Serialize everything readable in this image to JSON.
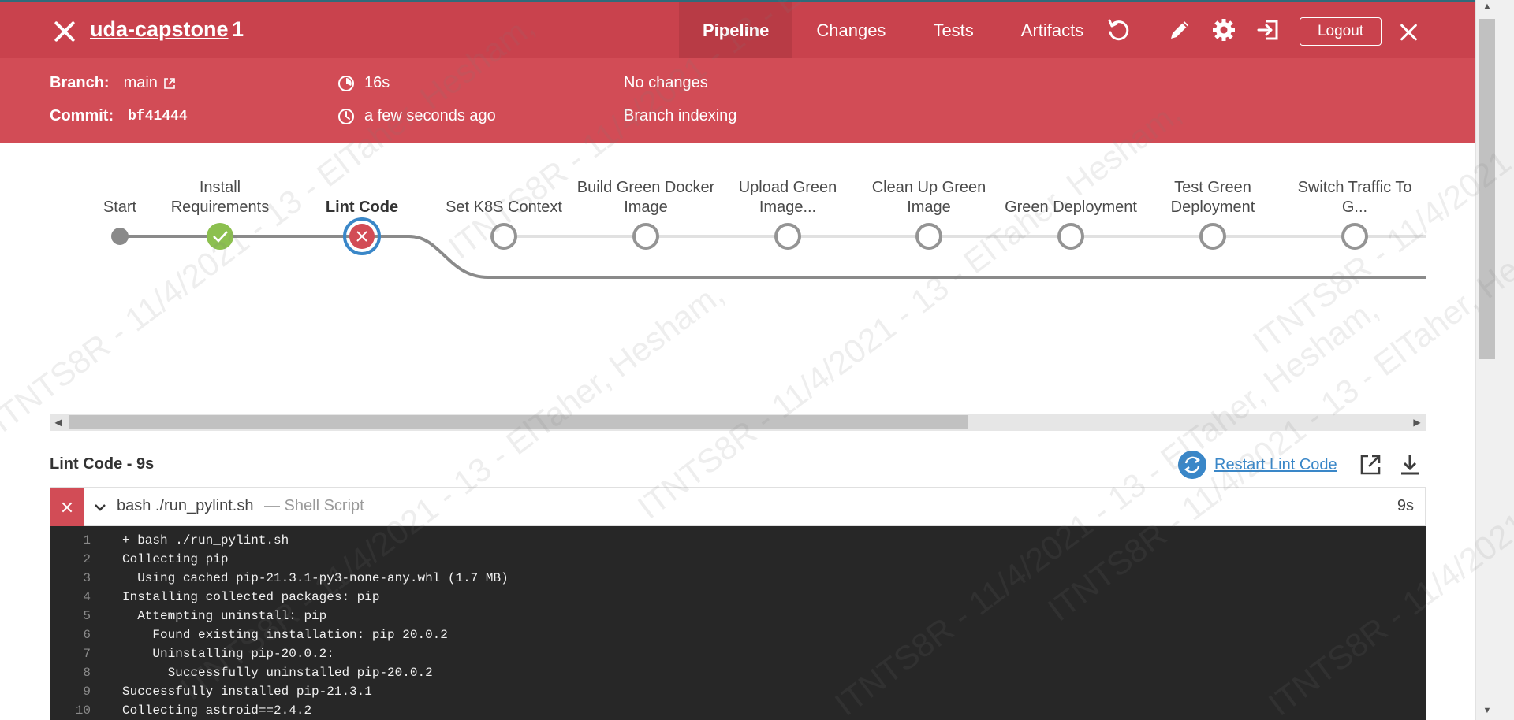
{
  "header": {
    "title": "uda-capstone",
    "run_number": "1",
    "tabs": [
      {
        "label": "Pipeline",
        "active": true
      },
      {
        "label": "Changes",
        "active": false
      },
      {
        "label": "Tests",
        "active": false
      },
      {
        "label": "Artifacts",
        "active": false
      }
    ],
    "logout_label": "Logout"
  },
  "info": {
    "branch_label": "Branch:",
    "branch_value": "main",
    "commit_label": "Commit:",
    "commit_value": "bf41444",
    "duration": "16s",
    "time_ago": "a few seconds ago",
    "changes": "No changes",
    "cause": "Branch indexing"
  },
  "pipeline": {
    "stages": [
      {
        "label": "Start",
        "status": "start"
      },
      {
        "label": "Install Requirements",
        "status": "success"
      },
      {
        "label": "Lint Code",
        "status": "failed"
      },
      {
        "label": "Set K8S Context",
        "status": "not-built"
      },
      {
        "label": "Build Green Docker Image",
        "status": "not-built"
      },
      {
        "label": "Upload Green Image...",
        "status": "not-built"
      },
      {
        "label": "Clean Up Green Image",
        "status": "not-built"
      },
      {
        "label": "Green Deployment",
        "status": "not-built"
      },
      {
        "label": "Test Green Deployment",
        "status": "not-built"
      },
      {
        "label": "Switch Traffic To G...",
        "status": "not-built"
      }
    ]
  },
  "stage_detail": {
    "title": "Lint Code - 9s",
    "restart_label": "Restart Lint Code",
    "step_command": "bash ./run_pylint.sh",
    "step_type": "— Shell Script",
    "step_duration": "9s"
  },
  "log": [
    {
      "n": "1",
      "text": "+ bash ./run_pylint.sh"
    },
    {
      "n": "2",
      "text": "Collecting pip"
    },
    {
      "n": "3",
      "text": "  Using cached pip-21.3.1-py3-none-any.whl (1.7 MB)"
    },
    {
      "n": "4",
      "text": "Installing collected packages: pip"
    },
    {
      "n": "5",
      "text": "  Attempting uninstall: pip"
    },
    {
      "n": "6",
      "text": "    Found existing installation: pip 20.0.2"
    },
    {
      "n": "7",
      "text": "    Uninstalling pip-20.0.2:"
    },
    {
      "n": "8",
      "text": "      Successfully uninstalled pip-20.0.2"
    },
    {
      "n": "9",
      "text": "Successfully installed pip-21.3.1"
    },
    {
      "n": "10",
      "text": "Collecting astroid==2.4.2"
    }
  ],
  "watermark_text": "ITNTS8R - 11/4/2021 - 13 - ElTaher, Hesham,",
  "colors": {
    "header_red": "#c9424d",
    "info_red": "#d24c56",
    "success_green": "#8cc04f",
    "failed_red": "#d24c56",
    "link_blue": "#3a87c8",
    "log_bg": "#272727"
  }
}
